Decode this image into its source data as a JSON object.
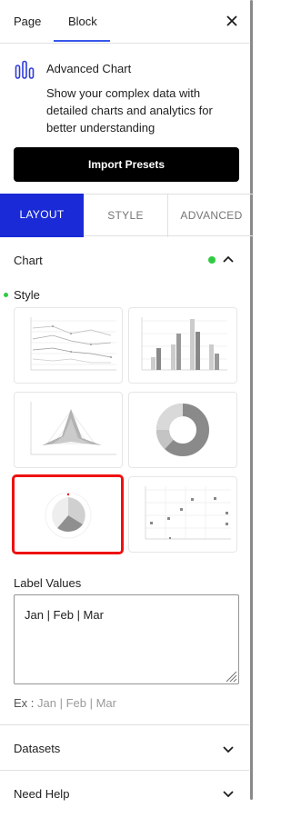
{
  "header": {
    "tabs": [
      {
        "label": "Page"
      },
      {
        "label": "Block"
      }
    ],
    "close_icon": "close-icon"
  },
  "block": {
    "icon": "advanced-chart-icon",
    "title": "Advanced Chart",
    "description": "Show your complex data with detailed charts and analytics for better understanding",
    "import_button": "Import Presets"
  },
  "section_tabs": [
    {
      "label": "LAYOUT"
    },
    {
      "label": "STYLE"
    },
    {
      "label": "ADVANCED"
    }
  ],
  "chart_panel": {
    "title": "Chart",
    "style_label": "Style",
    "presets": [
      {
        "name": "line"
      },
      {
        "name": "bar"
      },
      {
        "name": "radar"
      },
      {
        "name": "doughnut"
      },
      {
        "name": "polar-area",
        "selected": true
      },
      {
        "name": "scatter"
      }
    ]
  },
  "label_values": {
    "title": "Label Values",
    "value": "Jan | Feb | Mar",
    "example_prefix": "Ex : ",
    "example_value": "Jan | Feb | Mar"
  },
  "collapsed_sections": [
    {
      "label": "Datasets"
    },
    {
      "label": "Need Help"
    }
  ],
  "colors": {
    "accent": "#1a2ad6",
    "selected_border": "#ee1111",
    "status_dot": "#2ecc40"
  }
}
